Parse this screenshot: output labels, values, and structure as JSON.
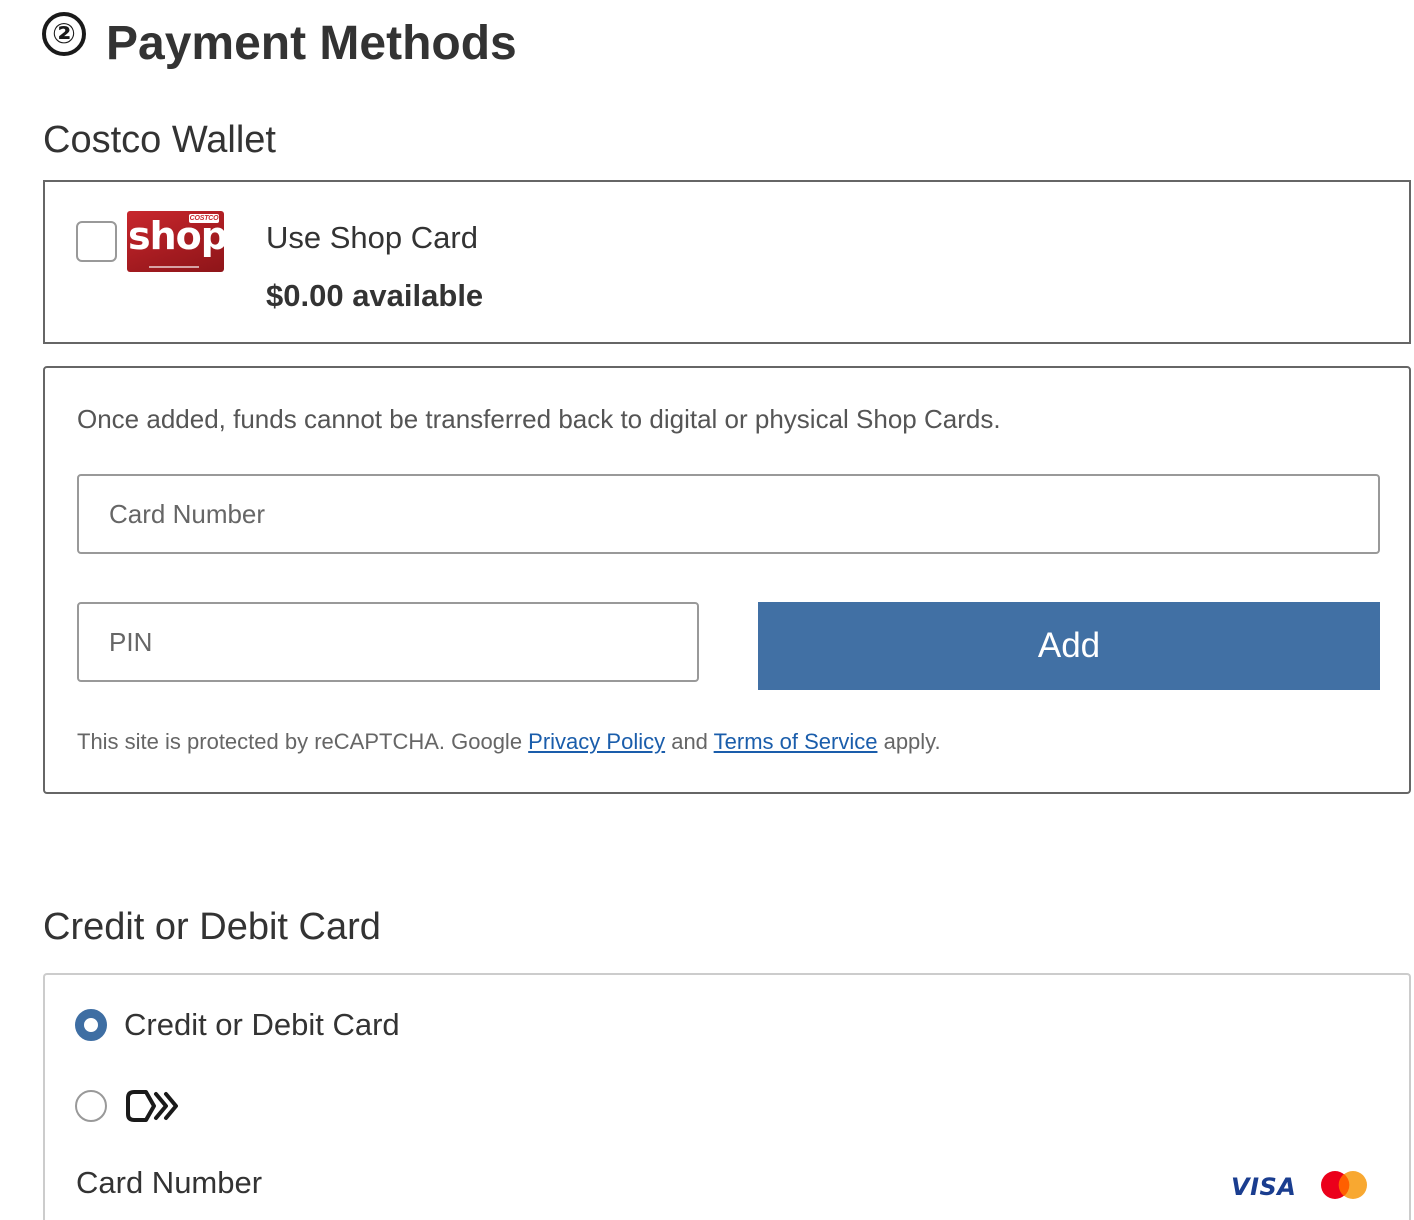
{
  "header": {
    "step_number": "②",
    "title": "Payment Methods"
  },
  "wallet": {
    "section_title": "Costco Wallet",
    "shop_card_logo": {
      "brand": "COSTCO",
      "word": "shop"
    },
    "use_label": "Use Shop Card",
    "available": "$0.00 available",
    "checked": false
  },
  "add_card": {
    "notice": "Once added, funds cannot be transferred back to digital or physical Shop Cards.",
    "card_number_placeholder": "Card Number",
    "pin_placeholder": "PIN",
    "add_label": "Add",
    "recaptcha_prefix": "This site is protected by reCAPTCHA. Google ",
    "privacy_link": "Privacy Policy",
    "recaptcha_and": " and ",
    "terms_link": "Terms of Service",
    "recaptcha_suffix": " apply."
  },
  "credit": {
    "section_title": "Credit or Debit Card",
    "options": [
      {
        "label": "Credit or Debit Card",
        "selected": true
      },
      {
        "icon": "link-pay-icon",
        "selected": false
      }
    ],
    "card_number_label": "Card Number",
    "brands": [
      "VISA",
      "mastercard-icon"
    ]
  },
  "colors": {
    "accent": "#4170a4",
    "link": "#1a5dab",
    "text": "#333333",
    "shop_card_red": "#c8272d"
  }
}
